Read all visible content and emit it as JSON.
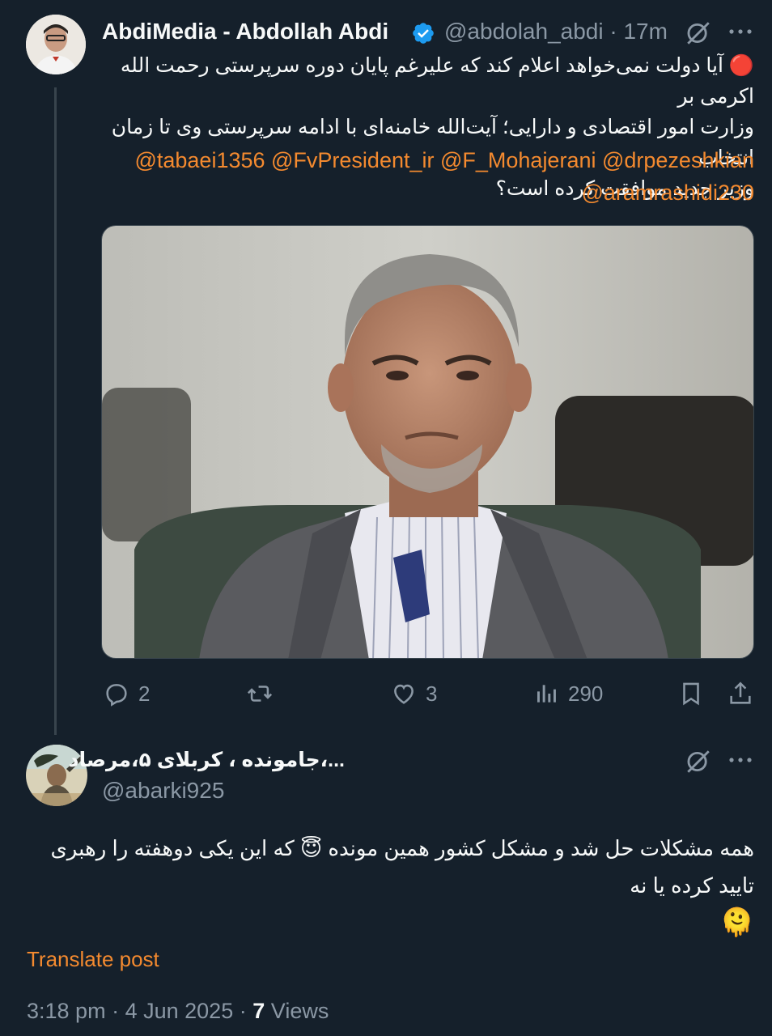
{
  "post": {
    "author_name": "AbdiMedia - Abdollah Abdi",
    "handle": "@abdolah_abdi",
    "separator": "·",
    "time": "17m",
    "text_line1": "🔴 آیا دولت نمی‌خواهد اعلام کند که علیرغم پایان دوره سرپرستی رحمت الله اکرمی بر",
    "text_line2": "وزارت امور اقتصادی و دارایی؛ آیت‌الله خامنه‌ای با ادامه سرپرستی وی تا زمان انتخاب",
    "text_line3": "وزیر جدید موافقت کرده است؟",
    "mentions_line1": "@tabaei1356 @FvPresident_ir @F_Mohajerani @drpezeshkian",
    "mentions_line2": "@aramrashidi230",
    "stats": {
      "replies": "2",
      "likes": "3",
      "views": "290"
    },
    "accent_color": "#f48a2f",
    "verified_color": "#1d9bf0"
  },
  "reply": {
    "author_name": "...،جامونده ، کربلای ۵،مرصاد",
    "handle": "@abarki925",
    "text_line1": "همه مشکلات حل شد و  مشکل کشور همین مونده 😇 که این یکی دوهفته را رهبری",
    "text_line2": "تایید کرده یا نه",
    "text_line3": "🫠",
    "translate_label": "Translate post",
    "time": "3:18 pm",
    "separator": "·",
    "date": "4 Jun 2025",
    "views_count": "7",
    "views_label": "Views"
  },
  "icons": [
    "grok-icon",
    "more-icon",
    "verified-badge-icon",
    "reply-icon",
    "retweet-icon",
    "like-icon",
    "views-icon",
    "bookmark-icon",
    "share-icon"
  ]
}
